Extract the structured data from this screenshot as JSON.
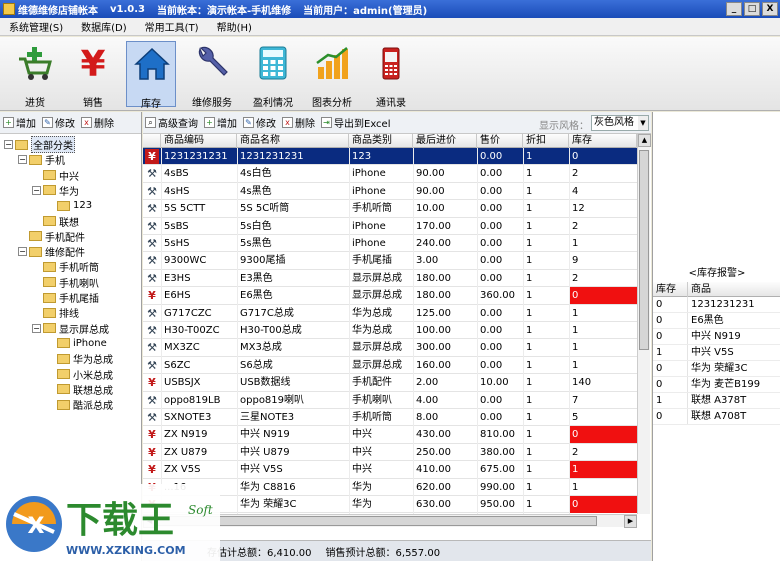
{
  "window": {
    "app_title": "维德维修店铺帐本",
    "version": "v1.0.3",
    "account": "当前帐本：演示帐本-手机维修",
    "user": "当前用户：admin(管理员)",
    "buttons": [
      "_",
      "□",
      "X"
    ]
  },
  "menu": [
    "系统管理(S)",
    "数据库(D)",
    "常用工具(T)",
    "帮助(H)"
  ],
  "toolbar": [
    {
      "label": "进货",
      "icon": "cart-plus-icon"
    },
    {
      "label": "销售",
      "icon": "yen-icon"
    },
    {
      "label": "库存",
      "icon": "house-icon",
      "active": true
    },
    {
      "label": "维修服务",
      "icon": "wrench-icon"
    },
    {
      "label": "盈利情况",
      "icon": "calculator-icon"
    },
    {
      "label": "图表分析",
      "icon": "bar-chart-icon"
    },
    {
      "label": "通讯录",
      "icon": "mobile-phone-icon"
    }
  ],
  "tree_toolbar": {
    "add": "增加",
    "edit": "修改",
    "delete": "删除"
  },
  "tree": [
    {
      "label": "全部分类",
      "level": 0,
      "expanded": true,
      "selected": true
    },
    {
      "label": "手机",
      "level": 1,
      "expanded": true
    },
    {
      "label": "中兴",
      "level": 2
    },
    {
      "label": "华为",
      "level": 2,
      "expanded": true
    },
    {
      "label": "123",
      "level": 3
    },
    {
      "label": "联想",
      "level": 2
    },
    {
      "label": "手机配件",
      "level": 1
    },
    {
      "label": "维修配件",
      "level": 1,
      "expanded": true
    },
    {
      "label": "手机听筒",
      "level": 2
    },
    {
      "label": "手机喇叭",
      "level": 2
    },
    {
      "label": "手机尾插",
      "level": 2
    },
    {
      "label": "排线",
      "level": 2
    },
    {
      "label": "显示屏总成",
      "level": 2,
      "expanded": true
    },
    {
      "label": "iPhone",
      "level": 3
    },
    {
      "label": "华为总成",
      "level": 3
    },
    {
      "label": "小米总成",
      "level": 3
    },
    {
      "label": "联想总成",
      "level": 3
    },
    {
      "label": "酷派总成",
      "level": 3
    }
  ],
  "grid_toolbar": {
    "search": "高级查询",
    "add": "增加",
    "edit": "修改",
    "delete": "删除",
    "export": "导出到Excel",
    "style_label": "显示风格：",
    "style_value": "灰色风格"
  },
  "grid": {
    "columns": [
      "商品编码",
      "商品名称",
      "商品类别",
      "最后进价",
      "售价",
      "折扣",
      "库存"
    ],
    "rows": [
      {
        "icon": "yen",
        "selected": true,
        "cells": [
          "1231231231",
          "1231231231",
          "123",
          "",
          "0.00",
          "1",
          "0"
        ]
      },
      {
        "icon": "wrench",
        "cells": [
          "4sBS",
          "4s白色",
          "iPhone",
          "90.00",
          "0.00",
          "1",
          "2"
        ]
      },
      {
        "icon": "wrench",
        "cells": [
          "4sHS",
          "4s黑色",
          "iPhone",
          "90.00",
          "0.00",
          "1",
          "4"
        ]
      },
      {
        "icon": "wrench",
        "cells": [
          "5S 5CTT",
          "5S 5C听筒",
          "手机听筒",
          "10.00",
          "0.00",
          "1",
          "12"
        ]
      },
      {
        "icon": "wrench",
        "cells": [
          "5sBS",
          "5s白色",
          "iPhone",
          "170.00",
          "0.00",
          "1",
          "2"
        ]
      },
      {
        "icon": "wrench",
        "cells": [
          "5sHS",
          "5s黑色",
          "iPhone",
          "240.00",
          "0.00",
          "1",
          "1"
        ]
      },
      {
        "icon": "wrench",
        "cells": [
          "9300WC",
          "9300尾插",
          "手机尾插",
          "3.00",
          "0.00",
          "1",
          "9"
        ]
      },
      {
        "icon": "wrench",
        "cells": [
          "E3HS",
          "E3黑色",
          "显示屏总成",
          "180.00",
          "0.00",
          "1",
          "2"
        ]
      },
      {
        "icon": "yen",
        "red_stock": true,
        "cells": [
          "E6HS",
          "E6黑色",
          "显示屏总成",
          "180.00",
          "360.00",
          "1",
          "0"
        ]
      },
      {
        "icon": "wrench",
        "cells": [
          "G717CZC",
          "G717C总成",
          "华为总成",
          "125.00",
          "0.00",
          "1",
          "1"
        ]
      },
      {
        "icon": "wrench",
        "cells": [
          "H30-T00ZC",
          "H30-T00总成",
          "华为总成",
          "100.00",
          "0.00",
          "1",
          "1"
        ]
      },
      {
        "icon": "wrench",
        "cells": [
          "MX3ZC",
          "MX3总成",
          "显示屏总成",
          "300.00",
          "0.00",
          "1",
          "1"
        ]
      },
      {
        "icon": "wrench",
        "cells": [
          "S6ZC",
          "S6总成",
          "显示屏总成",
          "160.00",
          "0.00",
          "1",
          "1"
        ]
      },
      {
        "icon": "yen",
        "cells": [
          "USBSJX",
          "USB数据线",
          "手机配件",
          "2.00",
          "10.00",
          "1",
          "140"
        ]
      },
      {
        "icon": "wrench",
        "cells": [
          "oppo819LB",
          "oppo819喇叭",
          "手机喇叭",
          "4.00",
          "0.00",
          "1",
          "7"
        ]
      },
      {
        "icon": "wrench",
        "cells": [
          "SXNOTE3",
          "三星NOTE3",
          "手机听筒",
          "8.00",
          "0.00",
          "1",
          "5"
        ]
      },
      {
        "icon": "yen",
        "red_stock": true,
        "cells": [
          "ZX N919",
          "中兴 N919",
          "中兴",
          "430.00",
          "810.00",
          "1",
          "0"
        ]
      },
      {
        "icon": "yen",
        "cells": [
          "ZX U879",
          "中兴 U879",
          "中兴",
          "250.00",
          "380.00",
          "1",
          "2"
        ]
      },
      {
        "icon": "yen",
        "red_stock": true,
        "cells": [
          "ZX V5S",
          "中兴 V5S",
          "中兴",
          "410.00",
          "675.00",
          "1",
          "1"
        ]
      },
      {
        "icon": "yen",
        "cells": [
          "...16",
          "华为 C8816",
          "华为",
          "620.00",
          "990.00",
          "1",
          "1"
        ]
      },
      {
        "icon": "yen",
        "red_stock": true,
        "cells": [
          "",
          "华为 荣耀3C",
          "华为",
          "630.00",
          "950.00",
          "1",
          "0"
        ]
      }
    ]
  },
  "status": {
    "stock_cost": "存估计总额：6,410.00",
    "sales_estimate": "销售预计总额：6,557.00"
  },
  "stock_alert": {
    "title": "<库存报警>",
    "columns": [
      "库存",
      "商品"
    ],
    "rows": [
      [
        "0",
        "1231231231"
      ],
      [
        "0",
        "E6黑色"
      ],
      [
        "0",
        "中兴 N919"
      ],
      [
        "1",
        "中兴 V5S"
      ],
      [
        "0",
        "华为 荣耀3C"
      ],
      [
        "0",
        "华为 麦芒B199"
      ],
      [
        "1",
        "联想 A378T"
      ],
      [
        "0",
        "联想 A708T"
      ]
    ]
  },
  "watermark": {
    "brand": "下载王",
    "tag": "Soft",
    "url": "WWW.XZKING.COM"
  },
  "colors": {
    "accent": "#0a2b80",
    "alert": "#f01010",
    "watermark_green": "#2c8a2e"
  }
}
